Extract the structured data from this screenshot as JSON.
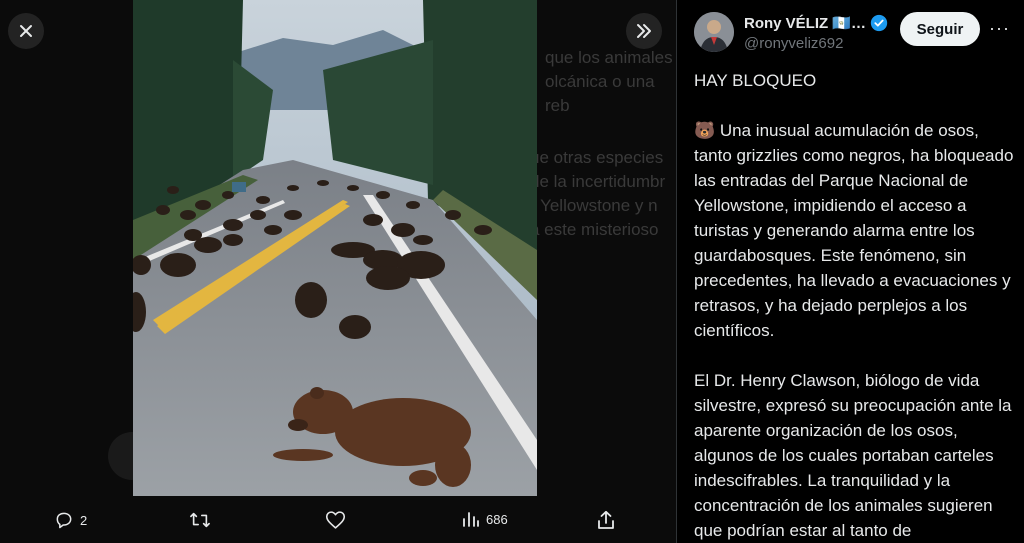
{
  "background_text": {
    "lines": [
      "que los animales",
      "olcánica o una reb",
      "ue otras especies",
      "de la incertidumbr",
      "r Yellowstone y n",
      "a este misterioso"
    ]
  },
  "icons": {
    "close": "close-icon",
    "expand": "chevrons-right-icon",
    "reply": "reply-icon",
    "retweet": "retweet-icon",
    "like": "heart-icon",
    "views": "views-icon",
    "share": "share-icon"
  },
  "actions": {
    "reply_count": "2",
    "views_count": "686"
  },
  "author": {
    "display_name": "Rony VÉLIZ 🇬🇹…",
    "handle": "@ronyveliz692",
    "verified": true
  },
  "follow_label": "Seguir",
  "more_label": "···",
  "post": {
    "paragraphs": [
      "HAY BLOQUEO",
      "🐻 Una inusual acumulación de osos, tanto grizzlies como negros, ha bloqueado las entradas del Parque Nacional de Yellowstone, impidiendo el acceso a turistas y generando alarma entre los guardabosques. Este fenómeno, sin precedentes, ha llevado a evacuaciones y retrasos, y ha dejado perplejos a los científicos.",
      "El Dr. Henry Clawson, biólogo de vida silvestre, expresó su preocupación ante la aparente organización de los osos, algunos de los cuales portaban carteles indescifrables. La tranquilidad y la concentración de los animales sugieren que podrían estar al tanto de"
    ]
  },
  "colors": {
    "verified": "#1d9bf0",
    "text": "#e7e9ea",
    "muted": "#71767b"
  }
}
